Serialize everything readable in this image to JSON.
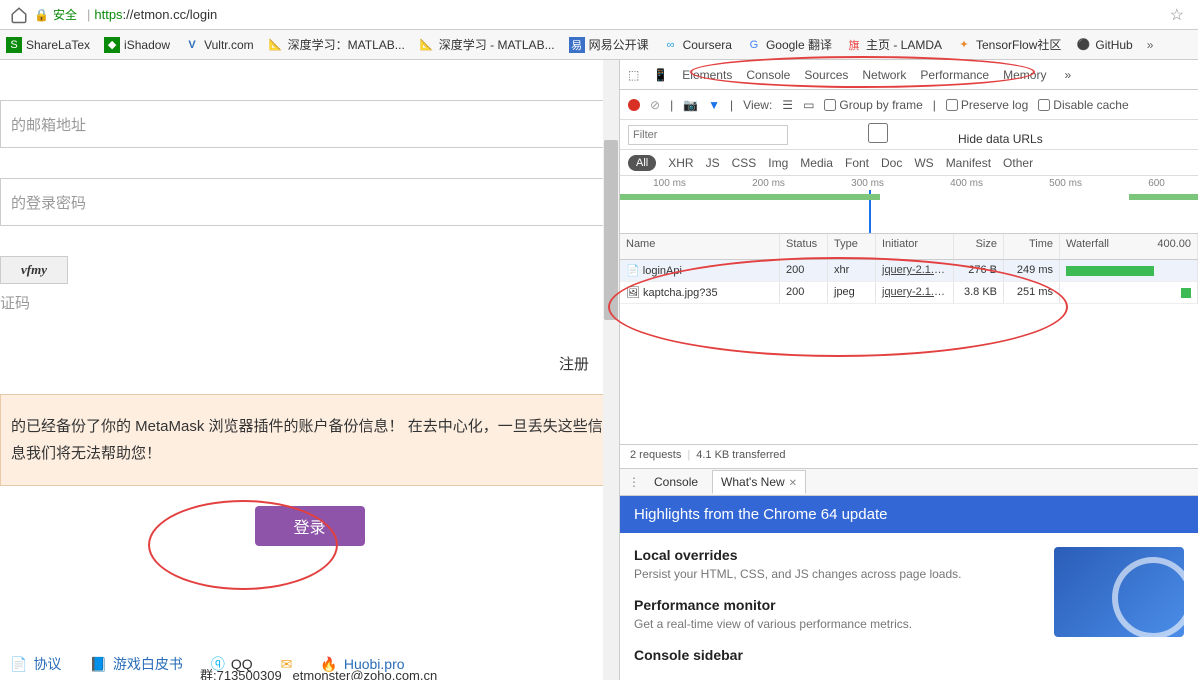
{
  "addressBar": {
    "secure_text": "安全",
    "url_https": "https",
    "url_rest": "://etmon.cc/login"
  },
  "bookmarks": [
    {
      "label": "ShareLaTex",
      "fav_bg": "#0a8a0a"
    },
    {
      "label": "iShadow",
      "fav_bg": "#0a8a0a"
    },
    {
      "label": "Vultr.com",
      "fav_bg": "#233"
    },
    {
      "label": "深度学习：MATLAB...",
      "fav_bg": "#e77c1e"
    },
    {
      "label": "深度学习 - MATLAB...",
      "fav_bg": "#e77c1e"
    },
    {
      "label": "网易公开课",
      "fav_bg": "#3b71c6"
    },
    {
      "label": "Coursera",
      "fav_bg": "#2aa0d8"
    },
    {
      "label": "Google 翻译",
      "fav_bg": "#2a88e8"
    },
    {
      "label": "主页 - LAMDA",
      "fav_bg": "#e44"
    },
    {
      "label": "TensorFlow社区",
      "fav_bg": "#e88a2e"
    },
    {
      "label": "GitHub",
      "fav_bg": "#222"
    }
  ],
  "login": {
    "email_ph": "的邮箱地址",
    "pwd_ph": "的登录密码",
    "captcha_text": "vfmy",
    "captcha_label": "证码",
    "register": "注册",
    "warning": "的已经备份了你的 MetaMask 浏览器插件的账户备份信息！ 在去中心化，一旦丢失这些信息我们将无法帮助您！",
    "login_btn": "登录"
  },
  "footer": {
    "agreement": "协议",
    "whitepaper": "游戏白皮书",
    "qq": "QQ",
    "huobi": "Huobi.pro",
    "qq_group": "群:713500309",
    "email": "etmonster@zoho.com.cn"
  },
  "devtools": {
    "tabs": [
      "Elements",
      "Console",
      "Sources",
      "Network",
      "Performance",
      "Memory"
    ],
    "toolbar": {
      "view": "View:",
      "group": "Group by frame",
      "preserve": "Preserve log",
      "disable": "Disable cache"
    },
    "filter_ph": "Filter",
    "hide_urls": "Hide data URLs",
    "type_filters": [
      "All",
      "XHR",
      "JS",
      "CSS",
      "Img",
      "Media",
      "Font",
      "Doc",
      "WS",
      "Manifest",
      "Other"
    ],
    "timeline_ticks": [
      "100 ms",
      "200 ms",
      "300 ms",
      "400 ms",
      "500 ms",
      "600"
    ],
    "net_headers": [
      "Name",
      "Status",
      "Type",
      "Initiator",
      "Size",
      "Time",
      "Waterfall",
      "400.00"
    ],
    "net_rows": [
      {
        "name": "loginApi",
        "status": "200",
        "type": "xhr",
        "initiator": "jquery-2.1.4....",
        "size": "276 B",
        "time": "249 ms"
      },
      {
        "name": "kaptcha.jpg?35",
        "status": "200",
        "type": "jpeg",
        "initiator": "jquery-2.1.4....",
        "size": "3.8 KB",
        "time": "251 ms"
      }
    ],
    "summary": {
      "requests": "2 requests",
      "transferred": "4.1 KB transferred"
    },
    "drawer_tabs": [
      "Console",
      "What's New"
    ],
    "highlights": "Highlights from the Chrome 64 update",
    "wn": [
      {
        "h": "Local overrides",
        "p": "Persist your HTML, CSS, and JS changes across page loads."
      },
      {
        "h": "Performance monitor",
        "p": "Get a real-time view of various performance metrics."
      },
      {
        "h": "Console sidebar",
        "p": ""
      }
    ]
  }
}
